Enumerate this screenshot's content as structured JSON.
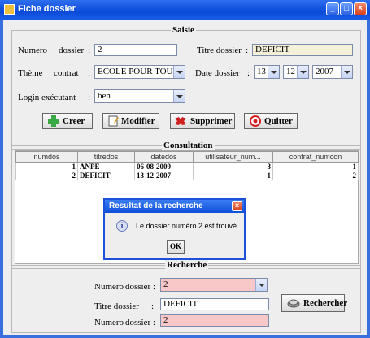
{
  "window": {
    "title": "Fiche dossier",
    "minimize": "_",
    "maximize": "□",
    "close": "×"
  },
  "saisie": {
    "legend": "Saisie",
    "numero_label": "Numero",
    "dossier_label": "dossier",
    "colon": ":",
    "numero_value": "2",
    "titre_label": "Titre dossier",
    "titre_value": "DEFICIT",
    "theme_label": "Thème",
    "contrat_label": "contrat",
    "theme_value": "ECOLE POUR TOUS",
    "date_label": "Date dossier",
    "date_day": "13",
    "date_month": "12",
    "date_year": "2007",
    "login_label": "Login exécutant",
    "login_value": "ben",
    "buttons": {
      "creer": "Creer",
      "modifier": "Modifier",
      "supprimer": "Supprimer",
      "quitter": "Quitter"
    }
  },
  "consultation": {
    "legend": "Consultation",
    "columns": [
      "numdos",
      "titredos",
      "datedos",
      "utilisateur_num...",
      "contrat_numcon"
    ],
    "rows": [
      [
        "1",
        "ANPE",
        "06-08-2009",
        "3",
        "1"
      ],
      [
        "2",
        "DEFICIT",
        "13-12-2007",
        "1",
        "2"
      ]
    ]
  },
  "dialog": {
    "title": "Resultat de la recherche",
    "message": "Le dossier numéro 2 est trouvé",
    "ok": "OK"
  },
  "recherche": {
    "legend": "Recherche",
    "numero_label": "Numero",
    "dossier_label": "dossier",
    "colon": ":",
    "numero_value": "2",
    "titre_label": "Titre dossier",
    "titre_value": "DEFICIT",
    "numero2_value": "2",
    "button": "Rechercher"
  },
  "colors": {
    "titlebar": "#0a4ad8",
    "pink_field": "#f8c8c8",
    "beige_field": "#f5f0d8"
  }
}
